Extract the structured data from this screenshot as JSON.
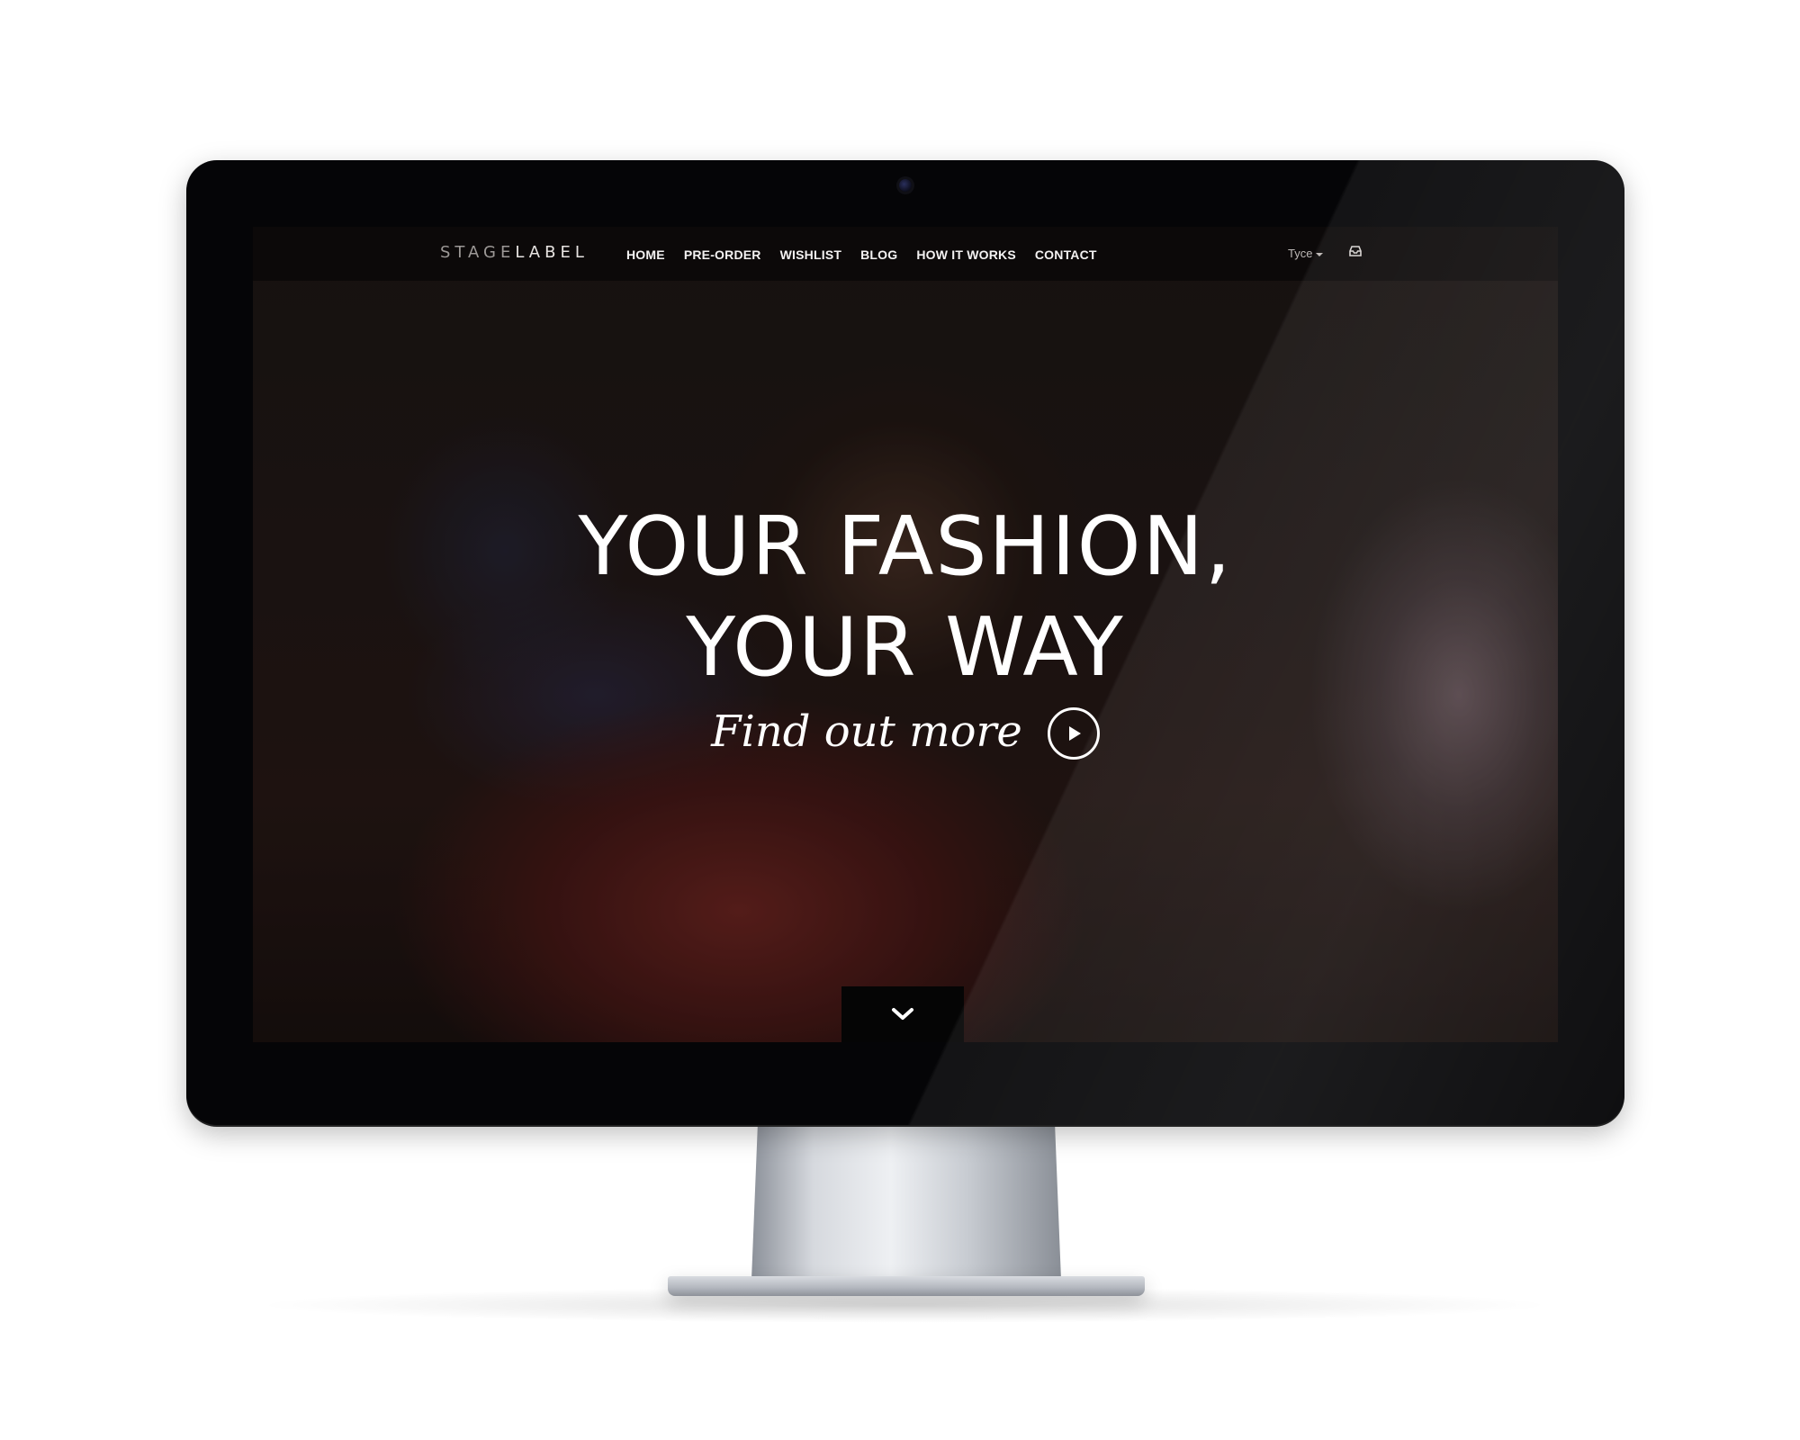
{
  "navbar": {
    "logo_part1": "STAGE",
    "logo_part2": "LABEL",
    "links": [
      {
        "label": "HOME"
      },
      {
        "label": "PRE-ORDER"
      },
      {
        "label": "WISHLIST"
      },
      {
        "label": "BLOG"
      },
      {
        "label": "HOW IT WORKS"
      },
      {
        "label": "CONTACT"
      }
    ],
    "user_name": "Tyce",
    "icons": {
      "user_caret": "caret-down-icon",
      "inbox": "inbox-icon"
    }
  },
  "hero": {
    "headline_line1": "YOUR FASHION,",
    "headline_line2": "YOUR WAY",
    "cta_label": "Find out more",
    "cta_icon": "play-icon",
    "scroll_icon": "chevron-down-icon"
  },
  "colors": {
    "navbar_bg": "#0a0808",
    "text_primary": "#ffffff",
    "bezel": "#050507"
  }
}
